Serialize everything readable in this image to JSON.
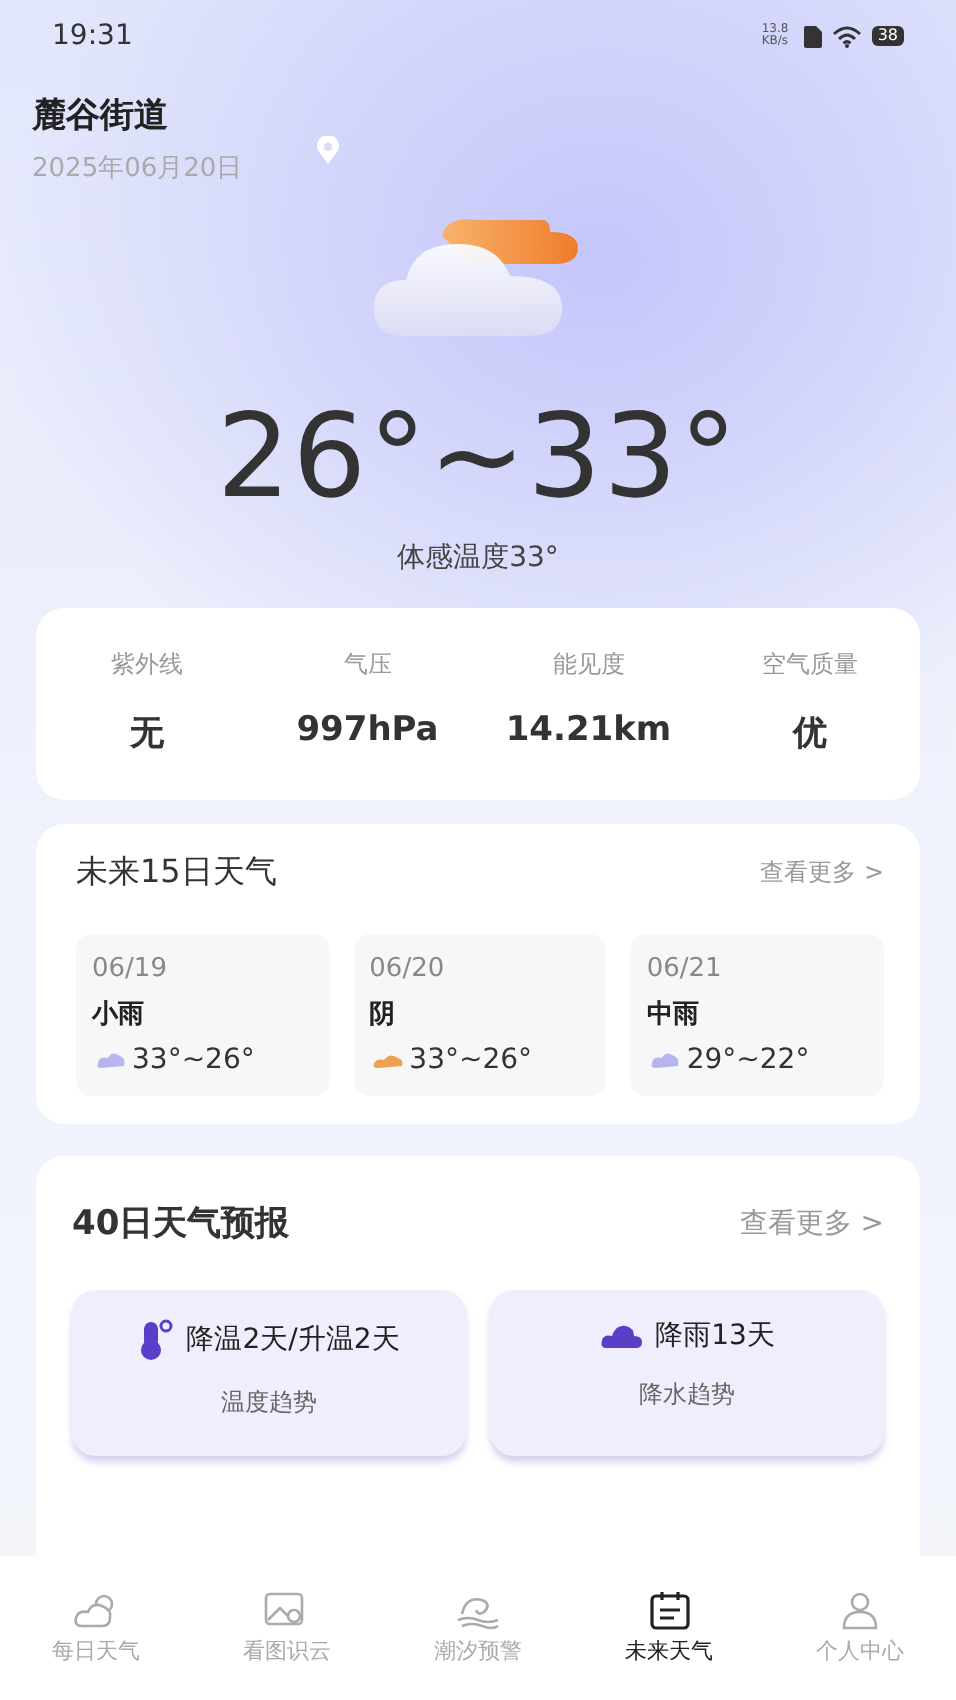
{
  "status_bar": {
    "time": "19:31",
    "net_speed": "13.8 KB/s",
    "battery": "38"
  },
  "header": {
    "location": "麓谷街道",
    "date": "2025年06月20日"
  },
  "current": {
    "temperature": "26°~33°",
    "feels_like": "体感温度33°"
  },
  "details": [
    {
      "label": "紫外线",
      "value": "无"
    },
    {
      "label": "气压",
      "value": "997hPa"
    },
    {
      "label": "能见度",
      "value": "14.21km"
    },
    {
      "label": "空气质量",
      "value": "优"
    }
  ],
  "forecast_15": {
    "title": "未来15日天气",
    "more": "查看更多",
    "more_icon": ">",
    "days": [
      {
        "date": "06/19",
        "condition": "小雨",
        "kind": "rain",
        "range": "33°~26°"
      },
      {
        "date": "06/20",
        "condition": "阴",
        "kind": "overcast",
        "range": "33°~26°"
      },
      {
        "date": "06/21",
        "condition": "中雨",
        "kind": "rain",
        "range": "29°~22°"
      }
    ]
  },
  "forecast_40": {
    "title": "40日天气预报",
    "more": "查看更多",
    "more_icon": ">",
    "trends": [
      {
        "kind": "temperature",
        "value": "降温2天/升温2天",
        "label": "温度趋势"
      },
      {
        "kind": "rain",
        "value": "降雨13天",
        "label": "降水趋势"
      }
    ]
  },
  "tab_bar": [
    {
      "label": "每日天气",
      "kind": "sun-cloud",
      "selected": false
    },
    {
      "label": "看图识云",
      "kind": "photo",
      "selected": false
    },
    {
      "label": "潮汐预警",
      "kind": "wave",
      "selected": false
    },
    {
      "label": "未来天气",
      "kind": "calendar",
      "selected": true
    },
    {
      "label": "个人中心",
      "kind": "person",
      "selected": false
    }
  ]
}
